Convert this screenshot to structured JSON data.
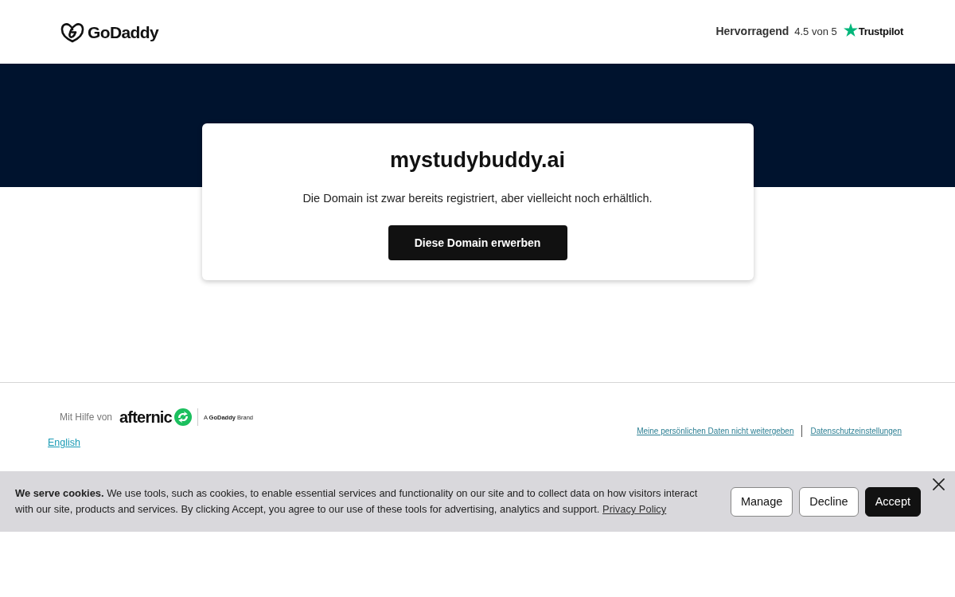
{
  "header": {
    "logo": "GoDaddy",
    "rating": {
      "label": "Hervorragend",
      "score": "4.5 von 5",
      "provider": "Trustpilot"
    }
  },
  "domain_card": {
    "domain": "mystudybuddy.ai",
    "message": "Die Domain ist zwar bereits registriert, aber vielleicht noch erhältlich.",
    "button": "Diese Domain erwerben"
  },
  "footer": {
    "powered_by": "Mit Hilfe von",
    "partner_logo": "afternic",
    "brand_note": "A **GoDaddy** Brand",
    "language_link": "English",
    "links": [
      "Meine persönlichen Daten nicht weitergeben",
      "Datenschutzeinstellungen"
    ]
  },
  "cookie_banner": {
    "message": "**We serve cookies.** We use tools, such as cookies, to enable essential services and functionality on our site and to collect data on how visitors interact with our site, products and services. By clicking Accept, you agree to our use of these tools for advertising, analytics and support.",
    "policy_link": "Privacy Policy",
    "buttons": [
      {
        "label": "Manage",
        "kind": "secondary"
      },
      {
        "label": "Decline",
        "kind": "secondary"
      },
      {
        "label": "Accept",
        "kind": "primary"
      }
    ]
  }
}
